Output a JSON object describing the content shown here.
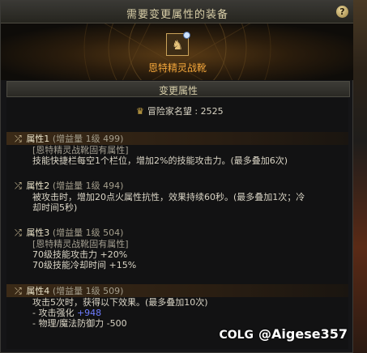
{
  "window": {
    "title": "需要变更属性的装备",
    "help_label": "?"
  },
  "item": {
    "name": "恩特精灵战靴"
  },
  "section": {
    "title": "变更属性"
  },
  "fame": {
    "label": "冒险家名望",
    "separator": " : ",
    "value": "2525"
  },
  "attributes": [
    {
      "name": "属性1",
      "gain": "(增益量 1级 499)",
      "lines": [
        "[恩特精灵战靴固有属性]",
        "技能快捷栏每空1个栏位，增加2%的技能攻击力。(最多叠加6次)"
      ]
    },
    {
      "name": "属性2",
      "gain": "(增益量 1级 494)",
      "lines": [
        "被攻击时，增加20点火属性抗性，效果持续60秒。(最多叠加1次；冷",
        "却时间5秒)"
      ]
    },
    {
      "name": "属性3",
      "gain": "(增益量 1级 504)",
      "lines": [
        "[恩特精灵战靴固有属性]",
        "70级技能攻击力 +20%",
        "70级技能冷却时间 +15%"
      ]
    },
    {
      "name": "属性4",
      "gain": "(增益量 1级 509)",
      "lines": [
        "攻击5次时，获得以下效果。(最多叠加10次)",
        "- 攻击强化 ",
        "- 物理/魔法防御力 -500"
      ],
      "buff_value": "+948"
    }
  ],
  "watermark": {
    "brand": "COLG",
    "handle": "@Aigese357"
  }
}
